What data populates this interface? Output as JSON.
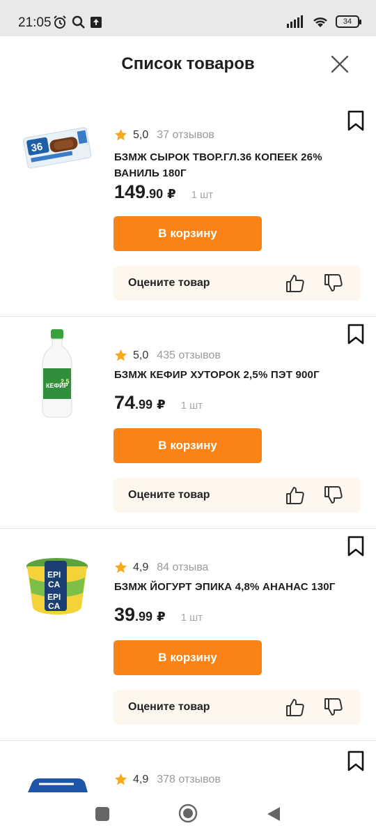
{
  "status": {
    "time": "21:05",
    "battery": "34"
  },
  "header": {
    "title": "Список товаров"
  },
  "products": [
    {
      "rating": "5,0",
      "reviews": "37 отзывов",
      "name": "БЗМЖ СЫРОК ТВОР.ГЛ.36 КОПЕЕК 26% ВАНИЛЬ 180Г",
      "price_int": "149",
      "price_frac": ".90",
      "currency": "₽",
      "qty": "1 шт",
      "cart_label": "В корзину",
      "rate_label": "Оцените товар",
      "image": "curd-snack-image"
    },
    {
      "rating": "5,0",
      "reviews": "435 отзывов",
      "name": "БЗМЖ КЕФИР ХУТОРОК 2,5% ПЭТ 900Г",
      "price_int": "74",
      "price_frac": ".99",
      "currency": "₽",
      "qty": "1 шт",
      "cart_label": "В корзину",
      "rate_label": "Оцените товар",
      "image": "kefir-bottle-image"
    },
    {
      "rating": "4,9",
      "reviews": "84 отзыва",
      "name": "БЗМЖ ЙОГУРТ ЭПИКА 4,8% АНАНАС 130Г",
      "price_int": "39",
      "price_frac": ".99",
      "currency": "₽",
      "qty": "1 шт",
      "cart_label": "В корзину",
      "rate_label": "Оцените товар",
      "image": "yogurt-cup-image"
    },
    {
      "rating": "4,9",
      "reviews": "378 отзывов",
      "image": "butter-pack-image"
    }
  ],
  "colors": {
    "accent": "#fb8315",
    "star": "#f7a81b",
    "rate_bg": "#fdf7ee"
  },
  "nav": {
    "icons": [
      "square-icon",
      "circle-home-icon",
      "back-triangle-icon"
    ]
  }
}
